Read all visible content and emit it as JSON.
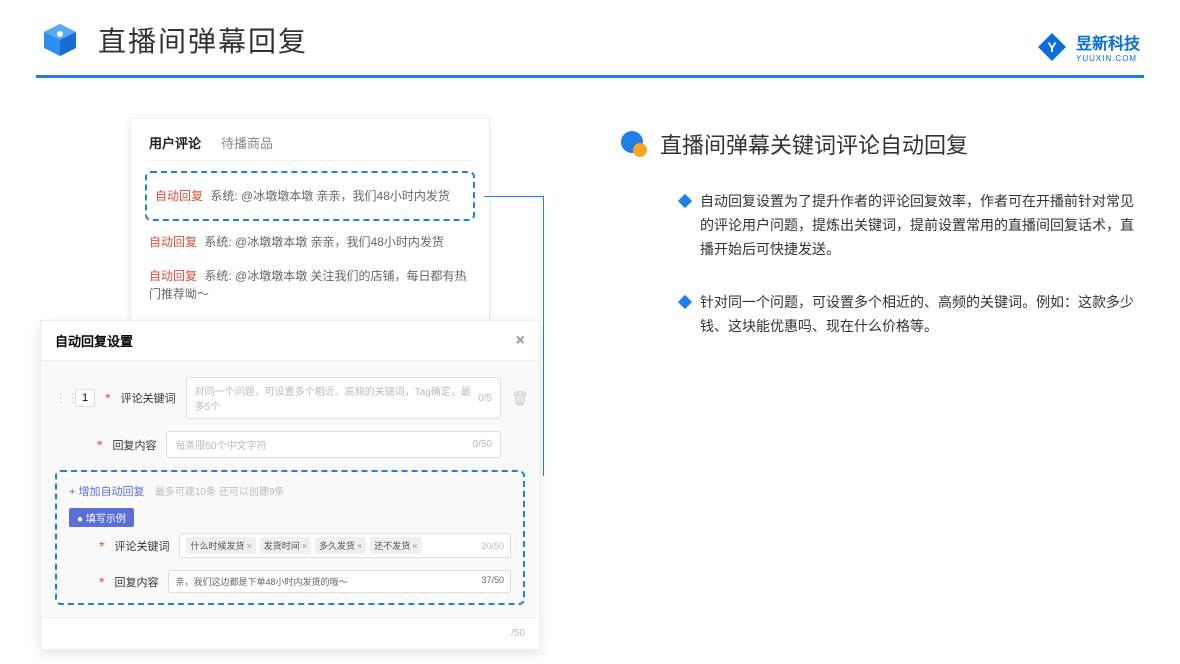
{
  "header": {
    "title": "直播间弹幕回复"
  },
  "brand": {
    "cn": "昱新科技",
    "en": "YUUXIN.COM"
  },
  "card1": {
    "tab1": "用户评论",
    "tab2": "待播商品",
    "autoReplyTag": "自动回复",
    "line1": "系统: @冰墩墩本墩 亲亲，我们48小时内发货",
    "line2": "系统: @冰墩墩本墩 亲亲，我们48小时内发货",
    "line3": "系统: @冰墩墩本墩 关注我们的店铺，每日都有热门推荐呦～"
  },
  "card2": {
    "title": "自动回复设置",
    "rowNum": "1",
    "label1": "评论关键词",
    "placeholder1": "对同一个问题，可设置多个相近、高频的关键词，Tag确定，最多5个",
    "count1": "0/5",
    "label2": "回复内容",
    "placeholder2": "每条限50个中文字符",
    "count2": "0/50",
    "addLink": "+ 增加自动回复",
    "addHint": "最多可建10条 还可以创建9条",
    "exampleBadge": "● 填写示例",
    "exLabel1": "评论关键词",
    "tag1": "什么时候发货",
    "tag2": "发货时间",
    "tag3": "多久发货",
    "tag4": "还不发货",
    "tagCount": "20/50",
    "exLabel2": "回复内容",
    "exValue": "亲，我们这边都是下单48小时内发货的哦～",
    "exCount": "37/50",
    "footCount": "/50"
  },
  "right": {
    "sectionTitle": "直播间弹幕关键词评论自动回复",
    "bullet1": "自动回复设置为了提升作者的评论回复效率，作者可在开播前针对常见的评论用户问题，提炼出关键词，提前设置常用的直播间回复话术，直播开始后可快捷发送。",
    "bullet2": "针对同一个问题，可设置多个相近的、高频的关键词。例如：这款多少钱、这块能优惠吗、现在什么价格等。"
  }
}
